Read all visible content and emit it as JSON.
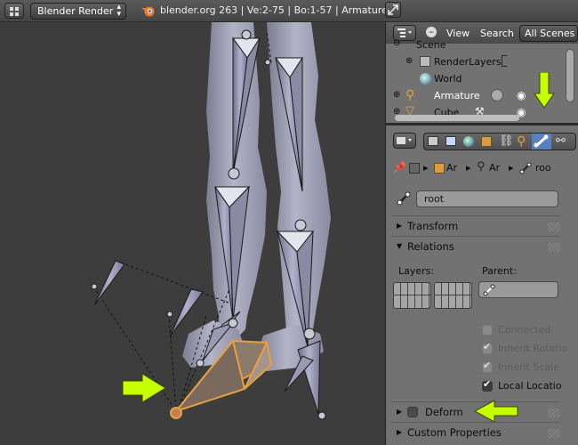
{
  "header": {
    "render_engine": "Blender Render",
    "info": "blender.org 263 | Ve:2-75 | Bo:1-57 | Armature"
  },
  "outliner": {
    "menu_view": "View",
    "menu_search": "Search",
    "display_mode": "All Scenes",
    "tree": [
      {
        "label": "Scene"
      },
      {
        "label": "RenderLayers"
      },
      {
        "label": "World"
      },
      {
        "label": "Armature"
      },
      {
        "label": "Cube"
      }
    ]
  },
  "properties": {
    "breadcrumb": [
      "Ar",
      "Ar",
      "roo"
    ],
    "bone_name": "root",
    "panels": {
      "transform": "Transform",
      "relations": "Relations",
      "deform": "Deform",
      "custom": "Custom Properties"
    },
    "relations": {
      "layers_label": "Layers:",
      "parent_label": "Parent:",
      "parent_value": "",
      "connected": "Connected",
      "inherit_rotation": "Inherit Rotatio",
      "inherit_scale": "Inherit Scale",
      "local_location": "Local Locatio"
    }
  },
  "colors": {
    "annotation_arrow": "#c6ff00",
    "selected_bone": "#e8a040",
    "active_tab": "#5680c2"
  }
}
